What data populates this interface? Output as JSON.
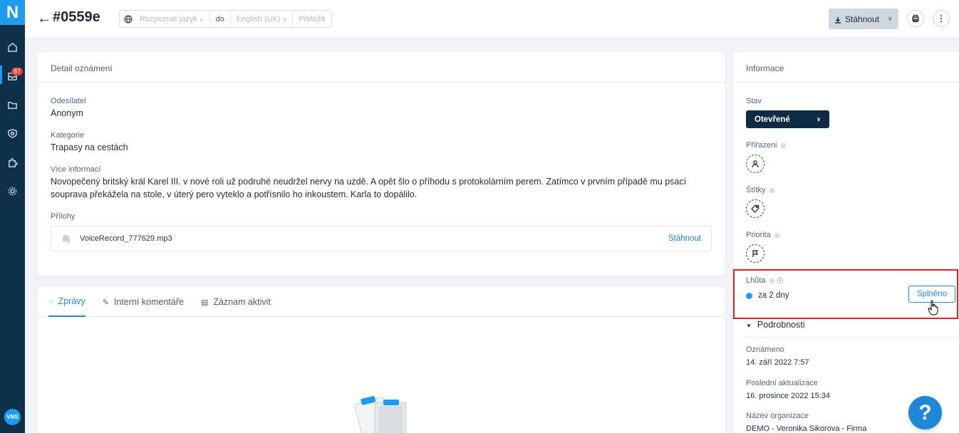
{
  "app": {
    "logo": "N",
    "inbox_badge": "87",
    "user_initials": "VNS"
  },
  "header": {
    "title": "#0559e",
    "translate": {
      "source": "Rozpoznat jazyk",
      "connector": "do",
      "target": "English (UK)",
      "action": "Přeložit"
    },
    "download_label": "Stáhnout"
  },
  "detail": {
    "card_title": "Detail oznámení",
    "sender_label": "Odesílatel",
    "sender_value": "Anonym",
    "category_label": "Kategorie",
    "category_value": "Trapasy na cestách",
    "more_label": "Více informací",
    "more_value": "Novopečený britský král Karel III. v nové roli už podruhé neudržel nervy na uzdě. A opět šlo o příhodu s protokolárním perem. Zatímco v prvním případě mu psací souprava překážela na stole, v úterý pero vyteklo a potřísnilo ho inkoustem. Karla to dopálilo.",
    "attachments_label": "Přílohy",
    "attachment_name": "VoiceRecord_777629.mp3",
    "attachment_download": "Stáhnout"
  },
  "tabs": [
    {
      "label": "Zprávy",
      "active": true
    },
    {
      "label": "Interní komentáře",
      "active": false
    },
    {
      "label": "Záznam aktivit",
      "active": false
    }
  ],
  "info": {
    "card_title": "Informace",
    "status_label": "Stav",
    "status_value": "Otevřené",
    "assigned_label": "Přiřazeni",
    "tags_label": "Štítky",
    "priority_label": "Priorita",
    "deadline_label": "Lhůta",
    "deadline_value": "za 2 dny",
    "done_button": "Splněno",
    "details_toggle": "Podrobnosti",
    "reported_label": "Oznámeno",
    "reported_value": "14. září 2022 7:57",
    "updated_label": "Poslední aktualizace",
    "updated_value": "16. prosince 2022 15:34",
    "org_label": "Název organizace",
    "org_value": "DEMO - Veronika Sikorova - Firma"
  },
  "help_button": "?",
  "colors": {
    "sidebar": "#0f3049",
    "accent": "#1d9bf0",
    "link": "#1d88d8",
    "status_button": "#0f2b44",
    "highlight_box": "#e02424"
  }
}
